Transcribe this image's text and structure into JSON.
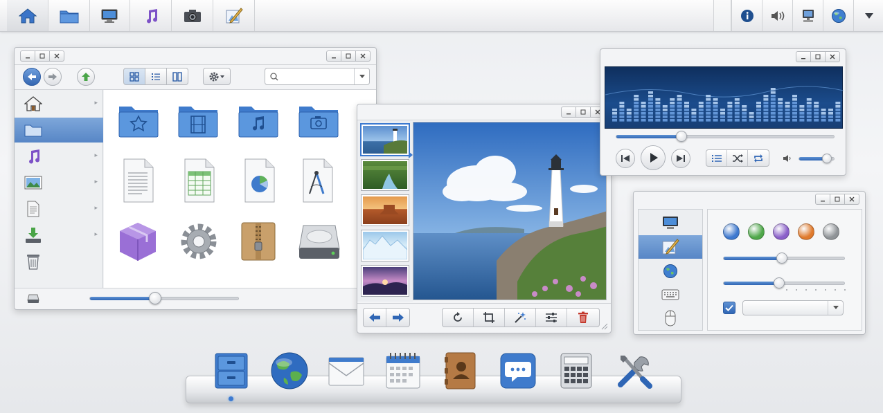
{
  "topbar": {
    "left_items": [
      {
        "icon": "home-icon",
        "active": true
      },
      {
        "icon": "folder-icon"
      },
      {
        "icon": "monitor-icon"
      },
      {
        "icon": "music-note-icon"
      },
      {
        "icon": "camera-icon"
      },
      {
        "icon": "drawing-tools-icon"
      }
    ],
    "right_items": [
      "info-icon",
      "speaker-icon",
      "network-icon",
      "globe-icon",
      "dropdown-arrow-icon"
    ]
  },
  "file_manager": {
    "search": {
      "value": "",
      "placeholder": ""
    },
    "view_modes": [
      "grid-view-icon",
      "list-view-icon",
      "column-view-icon"
    ],
    "selected_view": "grid",
    "sidebar": [
      "home-icon",
      "folder-icon",
      "music-note-icon",
      "picture-icon",
      "document-icon",
      "download-icon",
      "trash-icon"
    ],
    "selected_sidebar_index": 1,
    "items": [
      "favorites-folder-icon",
      "movies-folder-icon",
      "music-folder-icon",
      "pictures-folder-icon",
      "text-document-icon",
      "spreadsheet-icon",
      "chart-document-icon",
      "vector-drawing-icon",
      "package-icon",
      "settings-gear-icon",
      "archive-icon",
      "hard-drive-icon"
    ],
    "zoom_level": 0.44
  },
  "photo_viewer": {
    "thumbnails": [
      "lighthouse-thumbnail",
      "forest-stream-thumbnail",
      "desert-canyon-thumbnail",
      "glacier-thumbnail",
      "purple-sunset-thumbnail"
    ],
    "selected_index": 0,
    "tools": [
      "rotate-icon",
      "crop-icon",
      "magic-wand-icon",
      "adjust-sliders-icon",
      "trash-icon"
    ]
  },
  "media_player": {
    "progress": 0.3,
    "volume": 0.8,
    "equalizer_levels": [
      0.35,
      0.55,
      0.4,
      0.7,
      0.5,
      0.8,
      0.65,
      0.45,
      0.6,
      0.75,
      0.5,
      0.35,
      0.55,
      0.7,
      0.6,
      0.4,
      0.5,
      0.65,
      0.45,
      0.3,
      0.55,
      0.7,
      0.85,
      0.6,
      0.5,
      0.75,
      0.45,
      0.6,
      0.5,
      0.4,
      0.35,
      0.55
    ]
  },
  "settings": {
    "categories": [
      "display-icon",
      "appearance-icon",
      "globe-icon",
      "keyboard-icon",
      "mouse-icon"
    ],
    "selected_index": 1,
    "colors": [
      "#3e79cf",
      "#4fa84a",
      "#8a60c9",
      "#e07a2c",
      "#8f9397"
    ],
    "slider_1": 0.48,
    "slider_2": 0.46,
    "checkbox_checked": true,
    "dropdown_value": ""
  },
  "dock": [
    "file-cabinet-icon",
    "globe-icon",
    "mail-icon",
    "calendar-icon",
    "address-book-icon",
    "messages-icon",
    "calculator-icon",
    "system-tools-icon"
  ],
  "dock_running_index": 0
}
